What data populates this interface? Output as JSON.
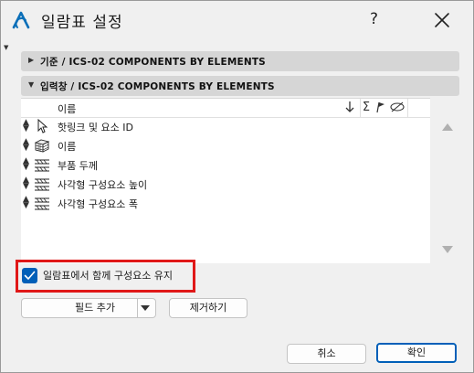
{
  "window": {
    "title": "일람표 설정",
    "help_label": "?",
    "brand_color": "#0b6fb8"
  },
  "sections": [
    {
      "label": "기준 / ICS-02 COMPONENTS BY ELEMENTS",
      "expanded": false
    },
    {
      "label": "입력창 / ICS-02 COMPONENTS BY ELEMENTS",
      "expanded": true
    }
  ],
  "list": {
    "header": {
      "name_col": "이름",
      "icons": [
        "sort-down-icon",
        "sum-icon",
        "flag-icon",
        "hide-icon"
      ]
    },
    "rows": [
      {
        "label": "핫링크 및 요소 ID",
        "icon": "pointer-icon"
      },
      {
        "label": "이름",
        "icon": "element-stack-icon"
      },
      {
        "label": "부품 두께",
        "icon": "hatch-layer-icon"
      },
      {
        "label": "사각형 구성요소 높이",
        "icon": "hatch-layer-icon"
      },
      {
        "label": "사각형 구성요소 폭",
        "icon": "hatch-layer-icon"
      }
    ]
  },
  "keep_components": {
    "label": "일람표에서 함께 구성요소 유지",
    "checked": true,
    "highlight_color": "#e01818",
    "accent_color": "#005fb8"
  },
  "buttons": {
    "add_field": "필드 추가",
    "remove": "제거하기",
    "cancel": "취소",
    "ok": "확인"
  }
}
